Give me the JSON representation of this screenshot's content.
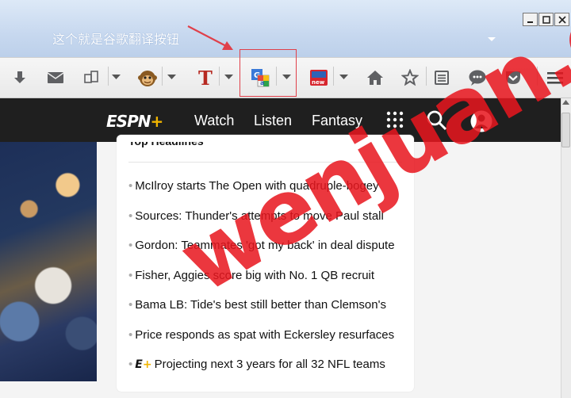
{
  "annotation": {
    "text": "这个就是谷歌翻译按钮"
  },
  "window_controls": {
    "minimize_icon": "minimize-icon",
    "maximize_icon": "maximize-icon",
    "close_icon": "close-icon"
  },
  "toolbar": {
    "items": [
      {
        "icon": "download-icon"
      },
      {
        "icon": "mail-icon"
      },
      {
        "icon": "share-icon"
      },
      {
        "icon": "monkey-icon"
      },
      {
        "icon": "text-t-icon"
      },
      {
        "icon": "google-translate-icon"
      },
      {
        "icon": "news-icon"
      },
      {
        "icon": "home-icon"
      },
      {
        "icon": "star-icon"
      },
      {
        "icon": "reading-list-icon"
      },
      {
        "icon": "chat-icon"
      },
      {
        "icon": "pocket-icon"
      },
      {
        "icon": "menu-icon"
      }
    ]
  },
  "espn": {
    "logo_text": "ESPN",
    "logo_plus": "+",
    "nav": [
      "Watch",
      "Listen",
      "Fantasy"
    ]
  },
  "card": {
    "title": "Top Headlines",
    "headlines": [
      "McIlroy starts The Open with quadruple-bogey",
      "Sources: Thunder's attempts to move Paul stall",
      "Gordon: Teammates 'got my back' in deal dispute",
      "Fisher, Aggies score big with No. 1 QB recruit",
      "Bama LB: Tide's best still better than Clemson's",
      "Price responds as spat with Eckersley resurfaces",
      "Projecting next 3 years for all 32 NFL teams"
    ],
    "eplus_logo": "E",
    "eplus_plus": "+"
  },
  "watermark": {
    "text": "wenjuan.cc"
  },
  "colors": {
    "accent": "#e0404a",
    "espn_plus": "#f0b400",
    "nav_bg": "#1f1f1f",
    "watermark": "#e8161e"
  }
}
